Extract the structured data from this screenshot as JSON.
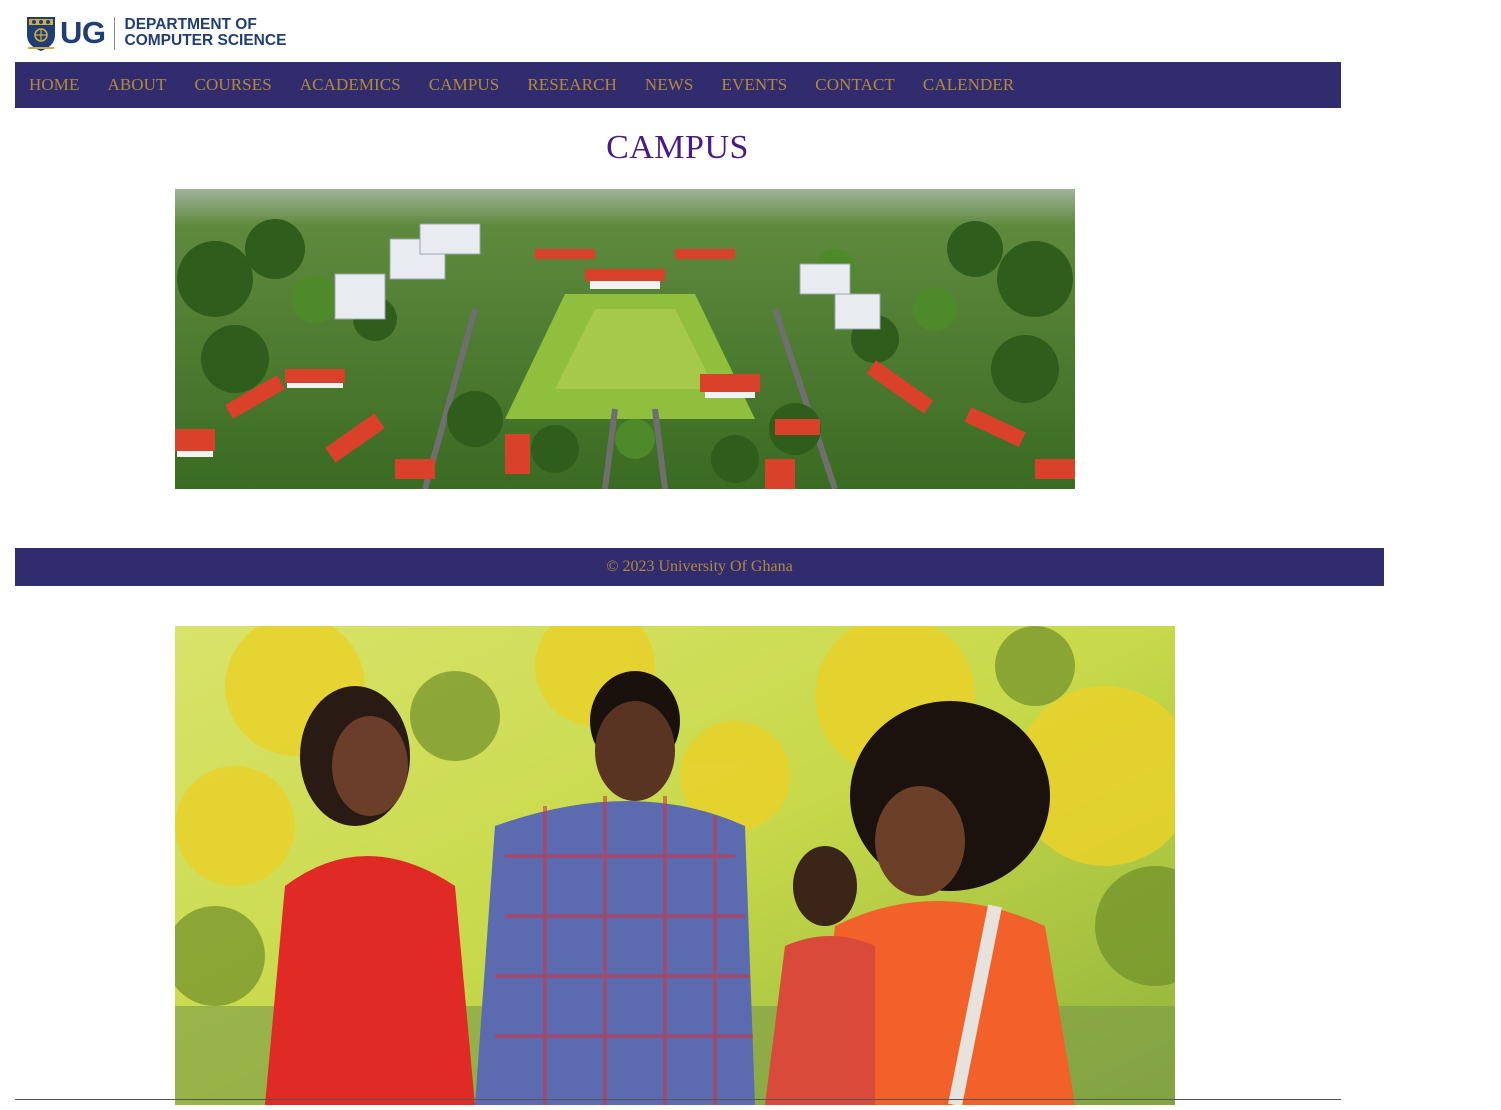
{
  "logo": {
    "abbreviation": "UG",
    "line1": "DEPARTMENT OF",
    "line2": "COMPUTER SCIENCE",
    "crest_icon": "university-crest-icon",
    "text_color": "#1f3e76"
  },
  "nav": {
    "background": "#312c6e",
    "link_color": "#b3893e",
    "items": [
      {
        "label": "HOME"
      },
      {
        "label": "ABOUT"
      },
      {
        "label": "COURSES"
      },
      {
        "label": "ACADEMICS"
      },
      {
        "label": "CAMPUS"
      },
      {
        "label": "RESEARCH"
      },
      {
        "label": "NEWS"
      },
      {
        "label": "EVENTS"
      },
      {
        "label": "CONTACT"
      },
      {
        "label": "CALENDER"
      }
    ]
  },
  "main": {
    "title": "CAMPUS",
    "title_color": "#4a1b86"
  },
  "footer": {
    "text": "© 2023 University Of Ghana"
  }
}
